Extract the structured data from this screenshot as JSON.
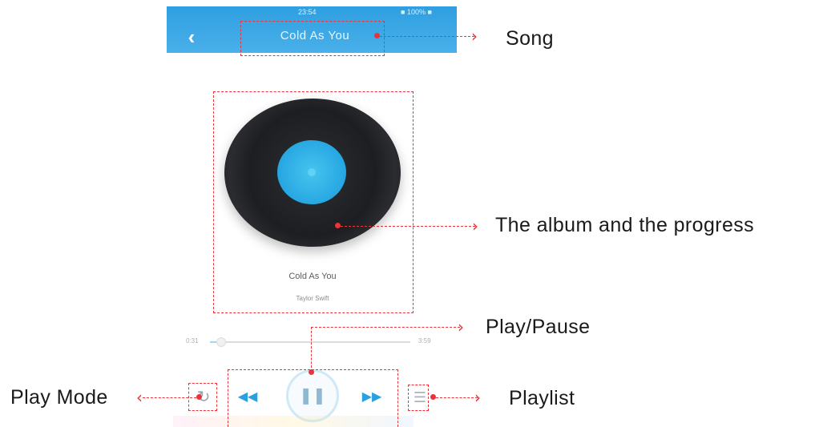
{
  "player": {
    "status_time": "23:54",
    "status_battery": "■ 100% ■",
    "title": "Cold As You",
    "album_title": "Cold As You",
    "album_artist": "Taylor Swift",
    "time_elapsed": "0:31",
    "time_total": "3:59",
    "progress": 0.05,
    "accent_color": "#2b9fe0",
    "icons": {
      "back": "chevron-left-icon",
      "mode": "repeat-icon",
      "prev": "previous-icon",
      "play": "pause-icon",
      "next": "next-icon",
      "list": "playlist-icon"
    }
  },
  "callouts": {
    "song": "Song",
    "album": "The album and the progress",
    "play_pause": "Play/Pause",
    "play_mode": "Play Mode",
    "playlist": "Playlist",
    "color": "#e8343a"
  }
}
